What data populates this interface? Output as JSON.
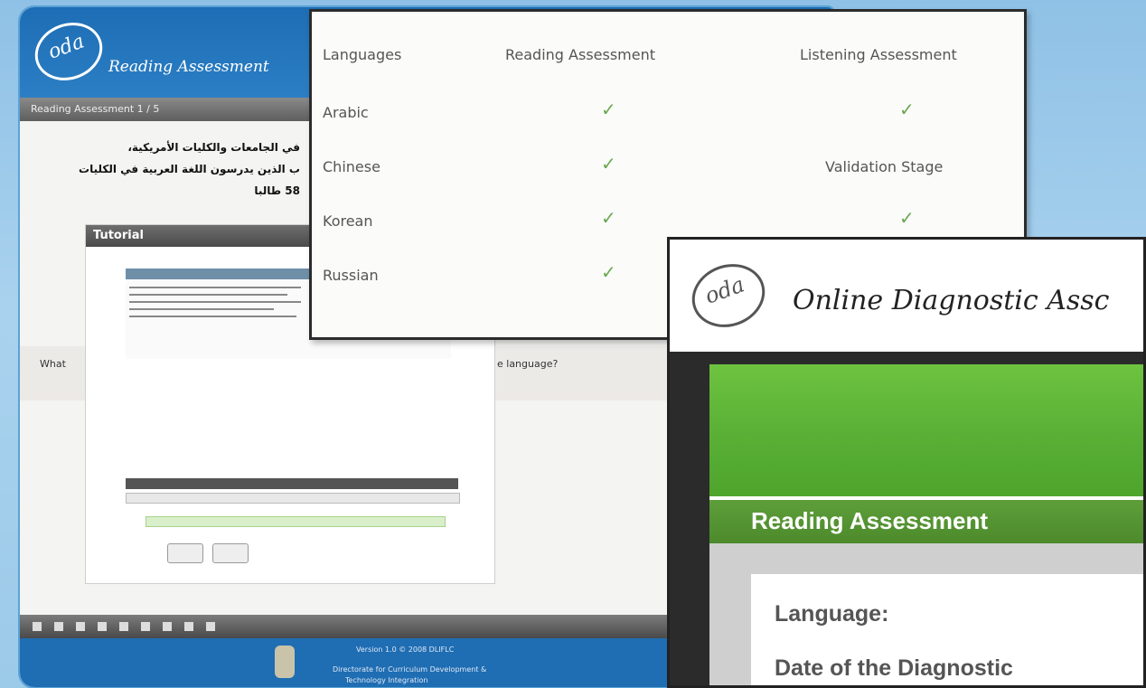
{
  "back_window": {
    "brand": "Reading Assessment",
    "logo_text": "oda",
    "subbar": "Reading Assessment  1 / 5",
    "arabic_lines": [
      "في الجامعات والكليات الأمريكية،",
      "ب الذين يدرسون اللغة العربية في الكليات",
      "58 طالبا"
    ],
    "tutorial_title": "Tutorial",
    "what_label": "What",
    "language_question": "e language?",
    "footer_lines": [
      "Version 1.0 © 2008 DLIFLC",
      "Directorate for Curriculum Development &",
      "Technology Integration"
    ]
  },
  "languages_table": {
    "headers": [
      "Languages",
      "Reading Assessment",
      "Listening Assessment"
    ],
    "rows": [
      {
        "language": "Arabic",
        "reading": "✓",
        "listening": "✓"
      },
      {
        "language": "Chinese",
        "reading": "✓",
        "listening": "Validation Stage"
      },
      {
        "language": "Korean",
        "reading": "✓",
        "listening": "✓"
      },
      {
        "language": "Russian",
        "reading": "✓",
        "listening": ""
      }
    ]
  },
  "oda_window": {
    "logo_text": "oda",
    "title": "Online Diagnostic Assc",
    "section_title": "Reading Assessment",
    "fields": [
      "Language:",
      "Date of the Diagnostic"
    ]
  },
  "colors": {
    "background": "#9ccae9",
    "header_blue": "#1d6db5",
    "green": "#5ab136",
    "check": "#6aa84f"
  }
}
